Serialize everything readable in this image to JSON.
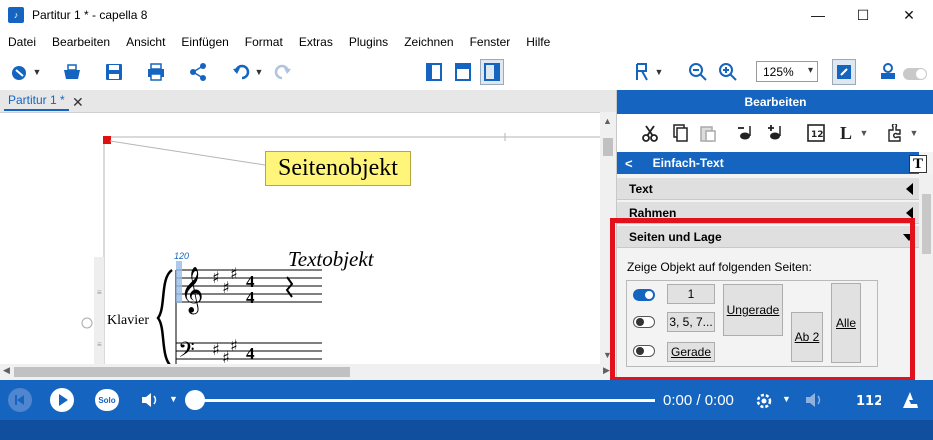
{
  "window": {
    "title": "Partitur 1 * - capella 8",
    "app_icon": "capella-icon",
    "minimize": "—",
    "maximize": "☐",
    "close": "✕"
  },
  "menu": [
    "Datei",
    "Bearbeiten",
    "Ansicht",
    "Einfügen",
    "Format",
    "Extras",
    "Plugins",
    "Zeichnen",
    "Fenster",
    "Hilfe"
  ],
  "toolbar": {
    "zoom_value": "125%"
  },
  "document": {
    "tab_label": "Partitur 1 *",
    "tab_close": "✕"
  },
  "score": {
    "page_object": "Seitenobjekt",
    "text_object": "Textobjekt",
    "instrument": "Klavier",
    "tempo": "120"
  },
  "panel": {
    "header": "Bearbeiten",
    "subheader": "Einfach-Text",
    "subheader_back": "<",
    "sections": {
      "text": "Text",
      "rahmen": "Rahmen",
      "seiten_lage": "Seiten und Lage"
    },
    "lage": {
      "label": "Zeige Objekt auf folgenden Seiten:",
      "btn_1": "1",
      "btn_odd_list": "3, 5, 7...",
      "btn_gerade": "Gerade",
      "btn_ungerade": "Ungerade",
      "btn_ab2": "Ab 2",
      "btn_alle": "Alle",
      "toggle_1": true,
      "toggle_odd": false,
      "toggle_gerade": false
    },
    "t_icon": "T"
  },
  "playback": {
    "solo": "Solo",
    "time": "0:00 / 0:00",
    "position": 0
  }
}
